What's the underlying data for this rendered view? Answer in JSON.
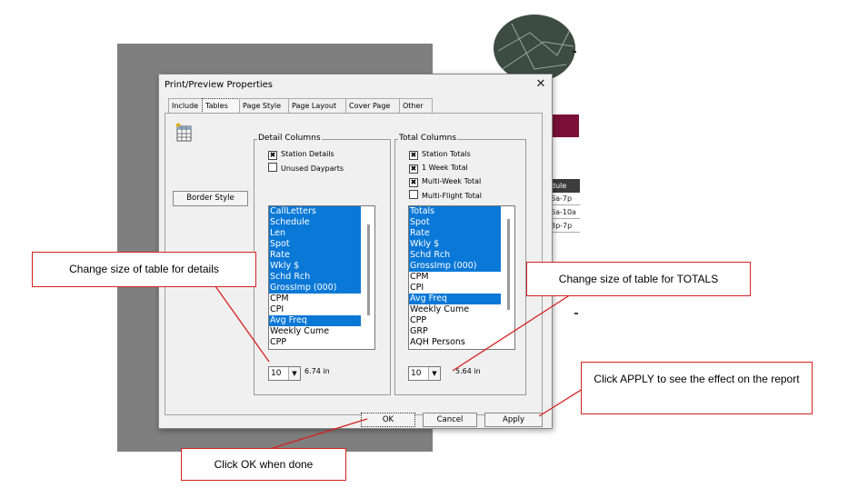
{
  "background": {
    "schedule_header": "dule",
    "schedule_cells": [
      "6a-7p",
      "6a-10a",
      "3p-7p"
    ]
  },
  "dialog": {
    "title": "Print/Preview Properties",
    "close_glyph": "✕",
    "tabs": [
      "Include",
      "Tables",
      "Page Style",
      "Page Layout",
      "Cover Page",
      "Other"
    ],
    "active_tab": "Tables",
    "border_style_label": "Border Style",
    "detail": {
      "group_label": "Detail Columns",
      "checks": [
        {
          "label": "Station Details",
          "checked": true
        },
        {
          "label": "Unused Dayparts",
          "checked": false
        }
      ],
      "items": [
        {
          "label": "CallLetters",
          "selected": true
        },
        {
          "label": "Schedule",
          "selected": true
        },
        {
          "label": "Len",
          "selected": true
        },
        {
          "label": "Spot",
          "selected": true
        },
        {
          "label": "Rate",
          "selected": true
        },
        {
          "label": "Wkly $",
          "selected": true
        },
        {
          "label": "Schd Rch",
          "selected": true
        },
        {
          "label": "GrossImp (000)",
          "selected": true
        },
        {
          "label": "CPM",
          "selected": false
        },
        {
          "label": "CPI",
          "selected": false
        },
        {
          "label": "Avg Freq",
          "selected": true
        },
        {
          "label": "Weekly Cume",
          "selected": false
        },
        {
          "label": "CPP",
          "selected": false
        }
      ],
      "font_size": "10",
      "width": "6.74 in"
    },
    "totals": {
      "group_label": "Total Columns",
      "checks": [
        {
          "label": "Station Totals",
          "checked": true
        },
        {
          "label": "1 Week Total",
          "checked": true
        },
        {
          "label": "Multi-Week Total",
          "checked": true
        },
        {
          "label": "Multi-Flight Total",
          "checked": false
        }
      ],
      "items": [
        {
          "label": "Totals",
          "selected": true
        },
        {
          "label": "Spot",
          "selected": true
        },
        {
          "label": "Rate",
          "selected": true
        },
        {
          "label": "Wkly $",
          "selected": true
        },
        {
          "label": "Schd Rch",
          "selected": true
        },
        {
          "label": "GrossImp (000)",
          "selected": true
        },
        {
          "label": "CPM",
          "selected": false
        },
        {
          "label": "CPI",
          "selected": false
        },
        {
          "label": "Avg Freq",
          "selected": true
        },
        {
          "label": "Weekly Cume",
          "selected": false
        },
        {
          "label": "CPP",
          "selected": false
        },
        {
          "label": "GRP",
          "selected": false
        },
        {
          "label": "AQH Persons",
          "selected": false
        }
      ],
      "font_size": "10",
      "width": "5.64 in"
    },
    "buttons": {
      "ok": "OK",
      "cancel": "Cancel",
      "apply": "Apply"
    }
  },
  "callouts": {
    "details": "Change size of table for details",
    "totals": "Change size of table for TOTALS",
    "apply": "Click APPLY to see the effect on the report",
    "ok": "Click OK when done"
  },
  "colors": {
    "selection": "#0a78d7",
    "callout_border": "#d62020",
    "accent_maroon": "#7a0f37"
  }
}
